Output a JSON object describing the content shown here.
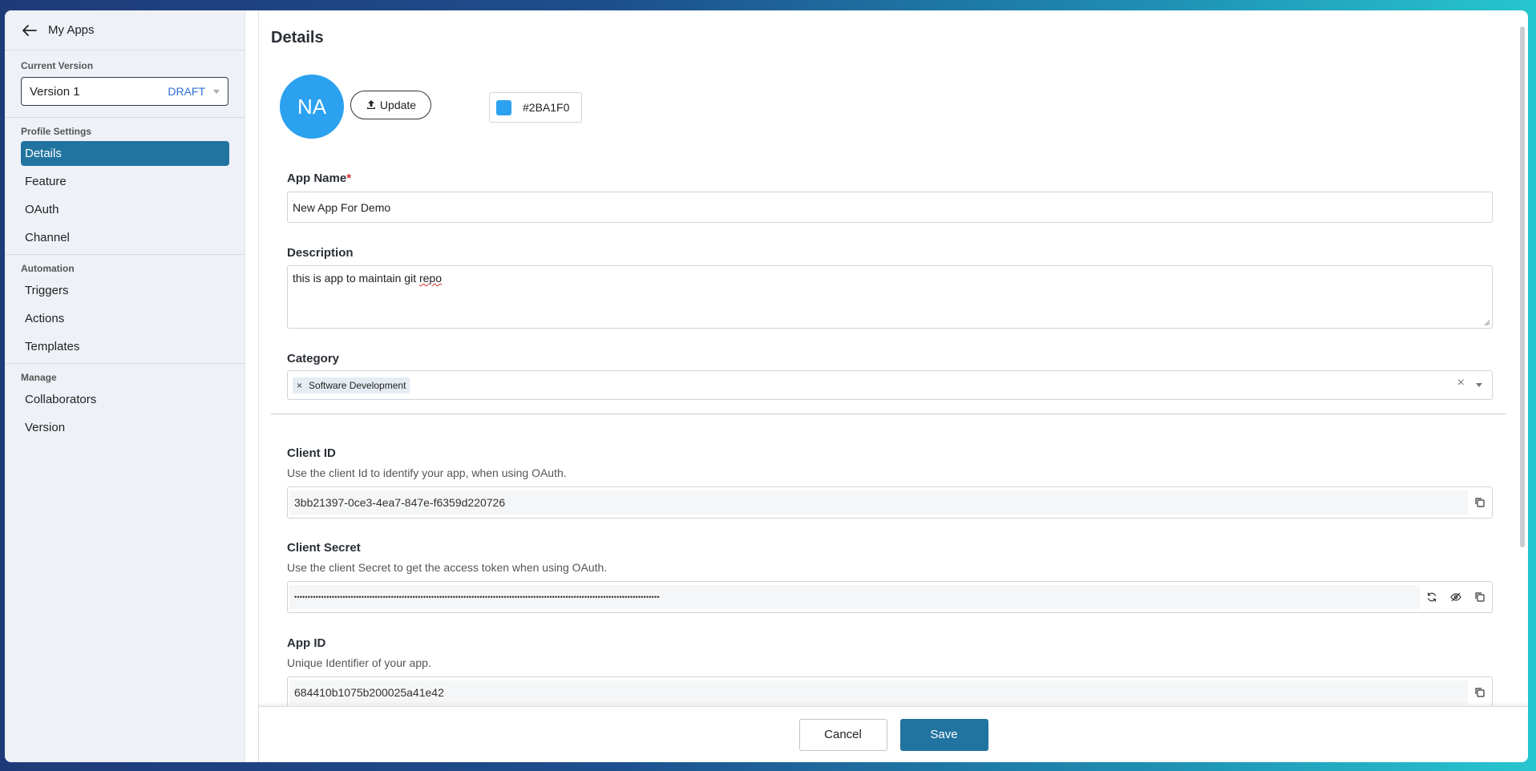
{
  "sidebar": {
    "back_label": "My Apps",
    "current_version_label": "Current Version",
    "version_name": "Version 1",
    "version_status": "DRAFT",
    "profile_settings_label": "Profile Settings",
    "profile_items": [
      "Details",
      "Feature",
      "OAuth",
      "Channel"
    ],
    "automation_label": "Automation",
    "automation_items": [
      "Triggers",
      "Actions",
      "Templates"
    ],
    "manage_label": "Manage",
    "manage_items": [
      "Collaborators",
      "Version"
    ]
  },
  "main": {
    "title": "Details",
    "avatar_initials": "NA",
    "avatar_color": "#2BA1F0",
    "update_label": "Update",
    "color_value": "#2BA1F0",
    "app_name": {
      "label": "App Name",
      "required_mark": "*",
      "value": "New App For Demo"
    },
    "description": {
      "label": "Description",
      "value_prefix": "this is app to maintain git ",
      "value_misspelled": "repo"
    },
    "category": {
      "label": "Category",
      "tag": "Software Development",
      "tag_remove": "×",
      "clear": "×"
    },
    "client_id": {
      "label": "Client ID",
      "help": "Use the client Id to identify your app, when using OAuth.",
      "value": "3bb21397-0ce3-4ea7-847e-f6359d220726"
    },
    "client_secret": {
      "label": "Client Secret",
      "help": "Use the client Secret to get the access token when using OAuth.",
      "value": "••••••••••••••••••••••••••••••••••••••••••••••••••••••••••••••••••••••••••••••••••••••••••••••••••••••••••••••••••••••••••••••••••••••••"
    },
    "app_id": {
      "label": "App ID",
      "help": "Unique Identifier of your app.",
      "value": "684410b1075b200025a41e42"
    }
  },
  "footer": {
    "cancel_label": "Cancel",
    "save_label": "Save"
  },
  "colors": {
    "accent": "#21749F",
    "active_nav": "#21749F"
  }
}
